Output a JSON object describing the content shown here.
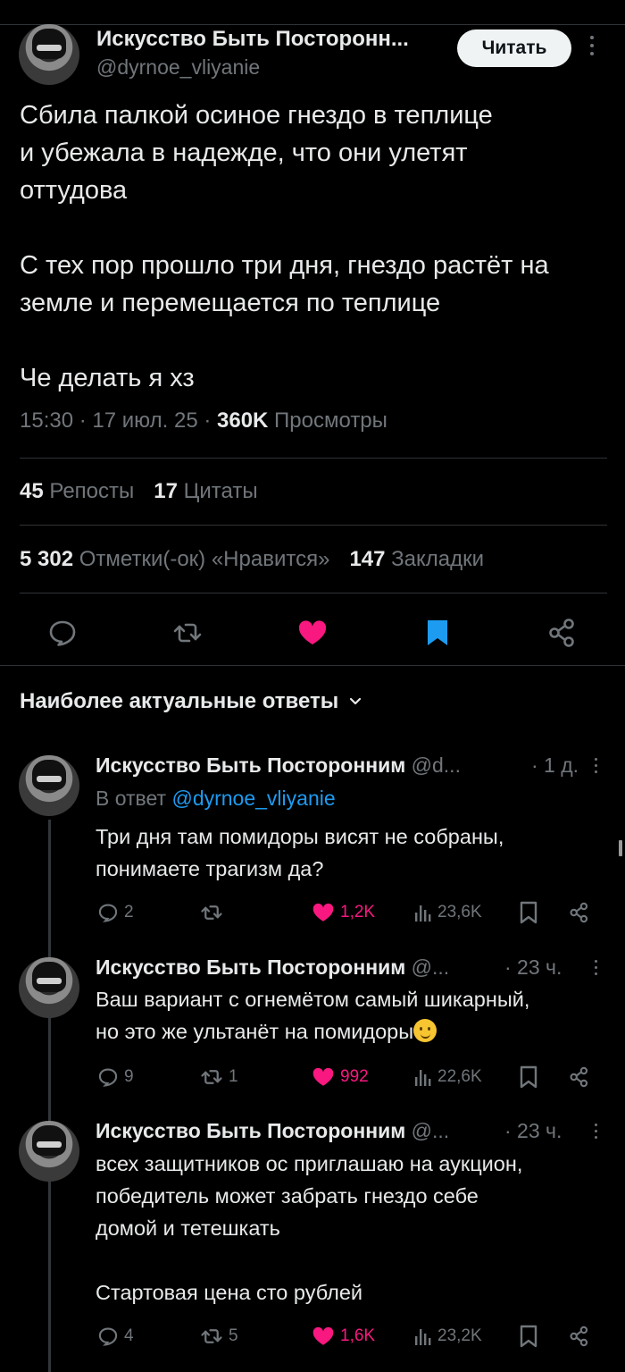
{
  "tweet": {
    "author_name": "Искусство Быть Посторонн...",
    "author_handle": "@dyrnoe_vliyanie",
    "follow_label": "Читать",
    "text": "Сбила палкой осиное гнездо в теплице\nи убежала в надежде, что они улетят\nоттудова\n\nС тех пор прошло три дня, гнездо растёт на\nземле и перемещается по теплице\n\nЧе делать я хз",
    "time": "15:30 · 17 июл. 25 · ",
    "views_count": "360K",
    "views_label": "Просмотры",
    "reposts_count": "45",
    "reposts_label": "Репосты",
    "quotes_count": "17",
    "quotes_label": "Цитаты",
    "likes_count": "5 302",
    "likes_label": "Отметки(-ок) «Нравится»",
    "bookmarks_count": "147",
    "bookmarks_label": "Закладки"
  },
  "replies_header": "Наиболее актуальные ответы",
  "colors": {
    "like": "#f91880",
    "bookmark": "#1d9bf0",
    "link": "#1d9bf0",
    "muted": "#71767b"
  },
  "replies": [
    {
      "name": "Искусство Быть Посторонним",
      "handle": "@d...",
      "time": "· 1 д.",
      "in_reply_prefix": "В ответ",
      "in_reply_handle": "@dyrnoe_vliyanie",
      "text": "Три дня там помидоры висят не собраны,\nпонимаете трагизм да?",
      "replies": "2",
      "reposts": "",
      "likes": "1,2K",
      "views": "23,6K"
    },
    {
      "name": "Искусство Быть Посторонним",
      "handle": "@...",
      "time": "· 23 ч.",
      "text": "Ваш вариант с огнемётом самый шикарный,\nно это же ультанёт на помидоры",
      "replies": "9",
      "reposts": "1",
      "likes": "992",
      "views": "22,6K"
    },
    {
      "name": "Искусство Быть Посторонним",
      "handle": "@...",
      "time": "· 23 ч.",
      "text": "всех защитников ос приглашаю на аукцион,\nпобедитель может забрать гнездо себе\nдомой и тетешкать\n\nСтартовая цена сто рублей",
      "replies": "4",
      "reposts": "5",
      "likes": "1,6K",
      "views": "23,2K"
    }
  ]
}
